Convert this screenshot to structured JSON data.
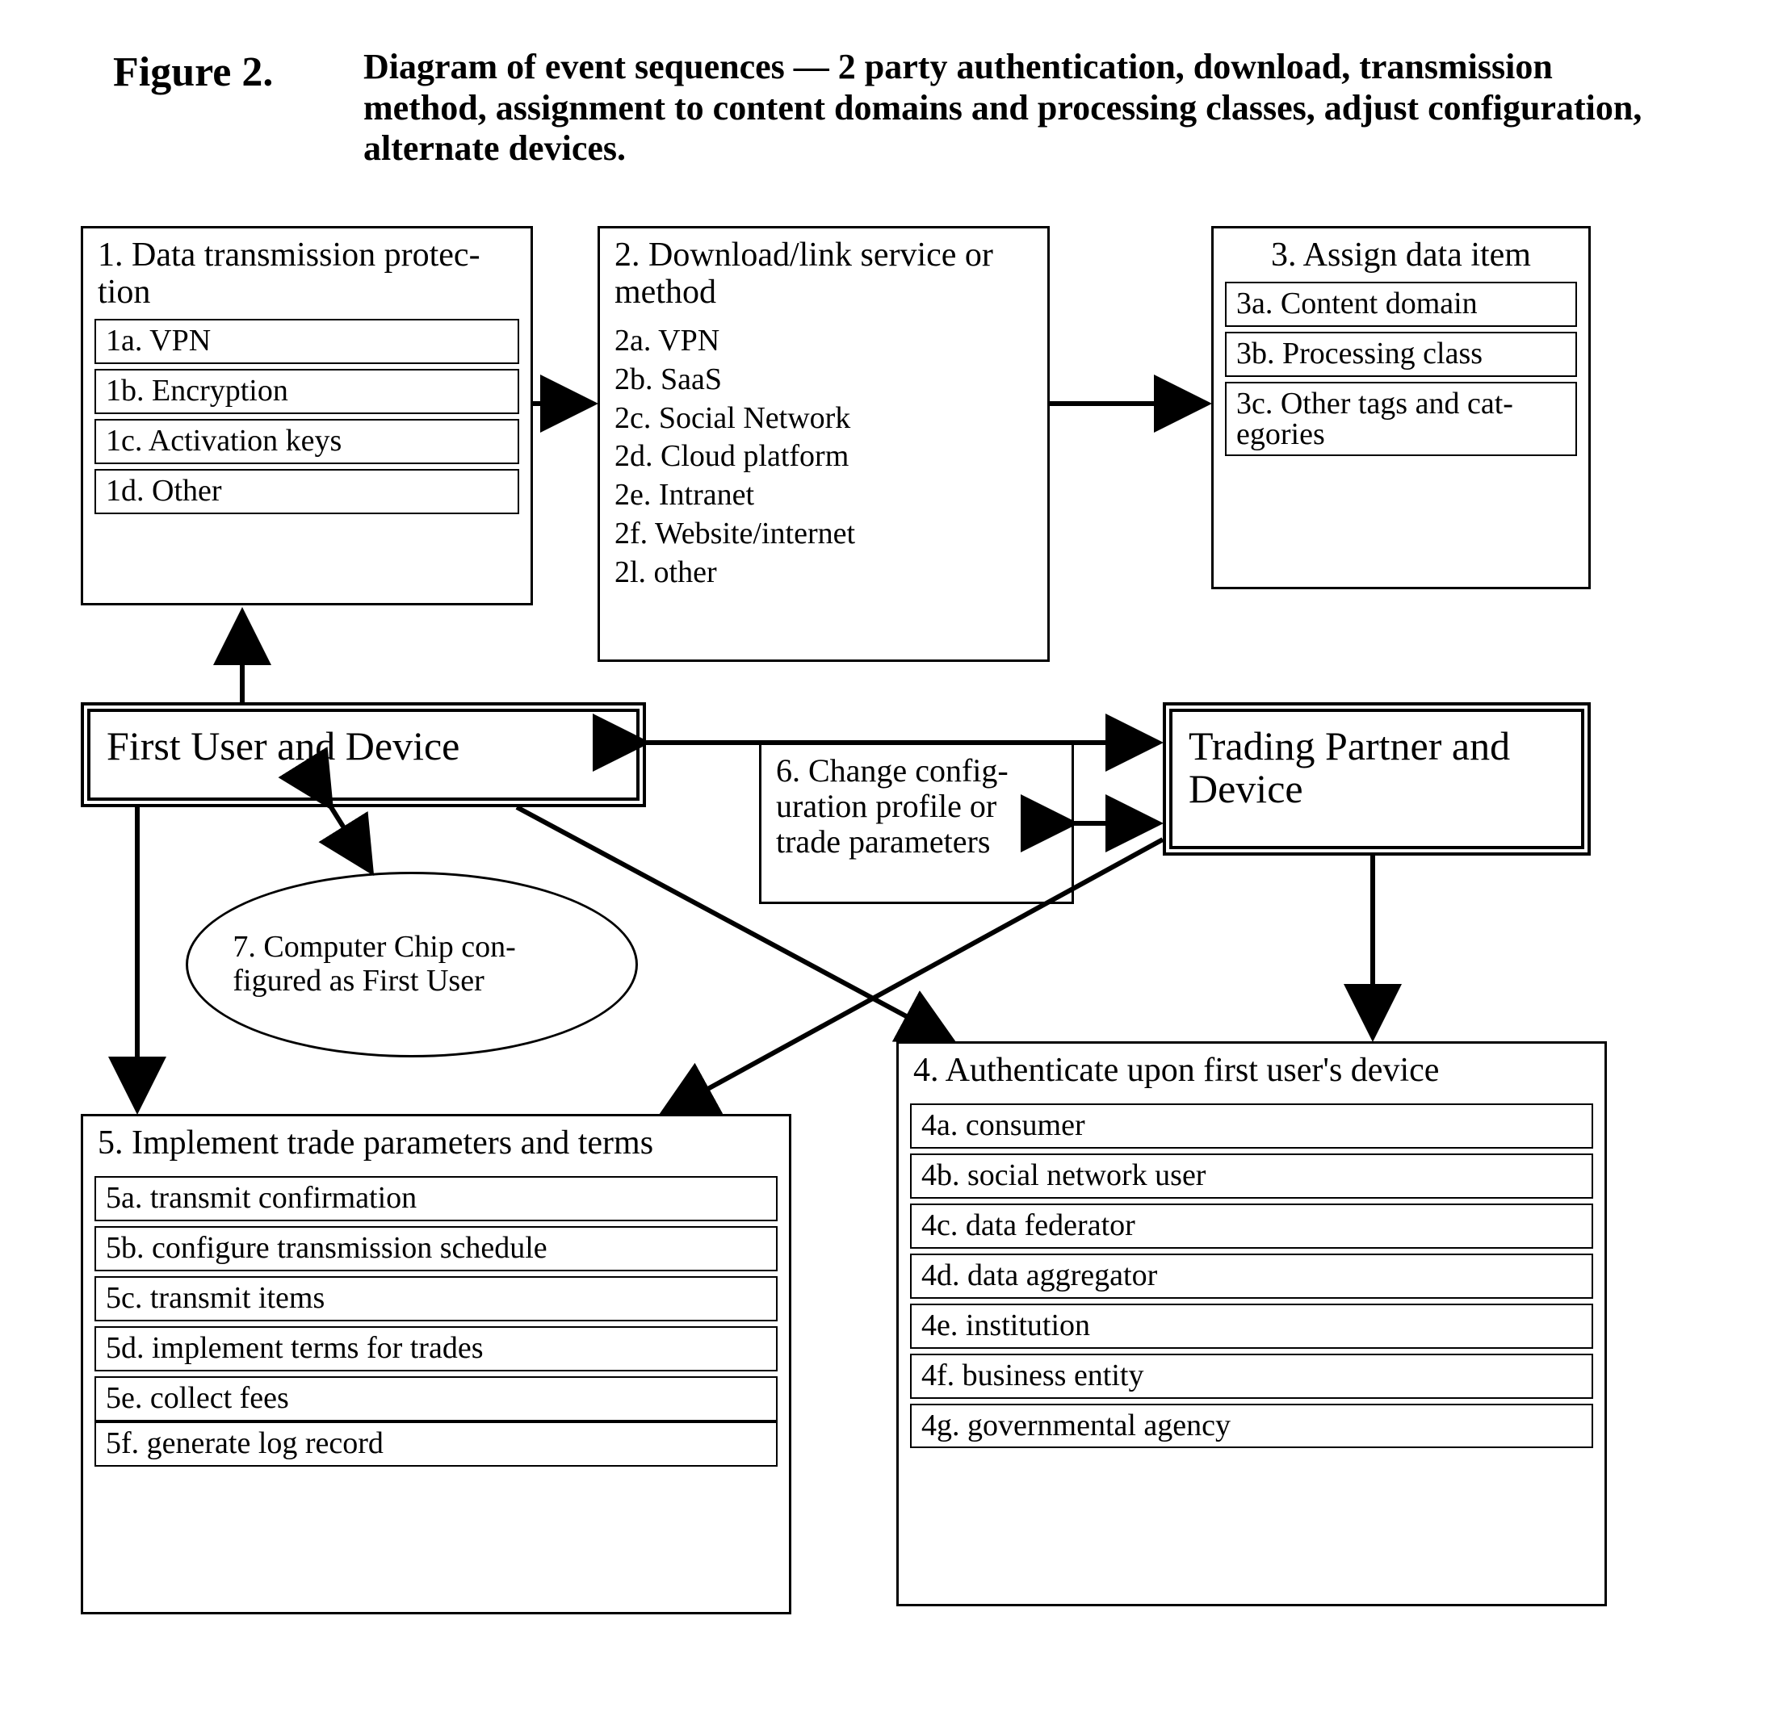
{
  "figure": {
    "label": "Figure 2.",
    "caption": "Diagram of event sequences — 2 party authentication, download, transmission method, assignment to content domains and processing classes, adjust configuration, alternate devices."
  },
  "box1": {
    "title": "1. Data transmission protec­tion",
    "a": "1a. VPN",
    "b": "1b. Encryption",
    "c": "1c. Activation keys",
    "d": "1d. Other"
  },
  "box2": {
    "title": "2. Download/link service or method",
    "a": "2a. VPN",
    "b": "2b. SaaS",
    "c": "2c. Social Network",
    "d": "2d. Cloud platform",
    "e": "2e. Intranet",
    "f": "2f. Website/internet",
    "g": "2l. other"
  },
  "box3": {
    "title": "3. Assign data item",
    "a": "3a.  Content domain",
    "b": "3b. Processing class",
    "c": "3c. Other tags and cat­egories"
  },
  "box4": {
    "title": "4. Authenticate upon first user's device",
    "a": "4a. consumer",
    "b": "4b. social network user",
    "c": "4c. data federator",
    "d": "4d. data aggregator",
    "e": "4e. institution",
    "f": "4f.  business entity",
    "g": "4g.  governmental agency"
  },
  "box5": {
    "title": "5. Implement trade parameters and terms",
    "a": "5a. transmit confirmation",
    "b": "5b. configure transmission schedule",
    "c": "5c. transmit items",
    "d": "5d. implement terms for trades",
    "e": "5e. collect fees",
    "f": "5f.  generate log record"
  },
  "box6": {
    "title": "6. Change config­uration profile or trade parameters"
  },
  "box7": {
    "text": "7. Computer Chip con­figured as First User"
  },
  "actors": {
    "first": "First User and Device",
    "partner": "Trading Partner and Device"
  }
}
